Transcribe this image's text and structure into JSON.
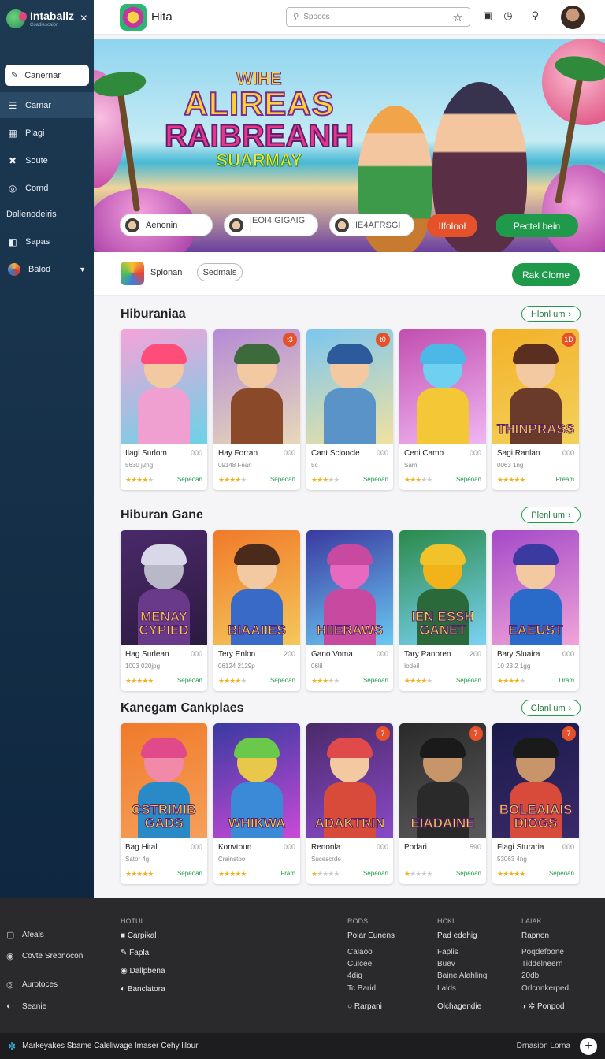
{
  "sidebar": {
    "logo_title": "Intaballz",
    "logo_subtitle": "Coadiescaion",
    "close_icon": "×",
    "primary_button": "Canernar",
    "items": [
      {
        "label": "Camar",
        "icon": "menu-icon",
        "active": true
      },
      {
        "label": "Plagi",
        "icon": "store-icon"
      },
      {
        "label": "Soute",
        "icon": "tools-icon"
      },
      {
        "label": "Comd",
        "icon": "chat-icon"
      }
    ],
    "group_label": "Dallenodeiris",
    "items2": [
      {
        "label": "Sapas",
        "icon": "bag-icon"
      },
      {
        "label": "Balod",
        "icon": "avatar-icon"
      }
    ]
  },
  "header": {
    "brand_name": "Hita",
    "search_placeholder": "Spoocs",
    "icons": [
      "bookmark-icon",
      "history-icon",
      "search-icon"
    ]
  },
  "hero": {
    "title_line1": "WIHE",
    "title_line2": "ALIREAS",
    "title_line3": "RAIBREANH",
    "title_line4": "SUARMAY",
    "pills": [
      "Aenonin",
      "IEOI4 GIGAIG I",
      "IE4AFRSGI"
    ],
    "button_orange": "Ilfolool",
    "button_green": "Pectel bein"
  },
  "filter": {
    "label": "Splonan",
    "chip": "Sedmals",
    "button": "Rak Clorne"
  },
  "sections": [
    {
      "title": "Hiburaniaa",
      "more": "Hlonl um",
      "cards": [
        {
          "name": "Ilagi Surlom",
          "num": "000",
          "sub": "5630 j2ng",
          "stars": 4,
          "stat": "Sepeoan",
          "badge": "",
          "thumb": "",
          "theme": [
            "#f6a3d8",
            "#6bd2e8",
            "#ff4d7a",
            "#f3c9a2",
            "#f0a0d0"
          ]
        },
        {
          "name": "Hay  Forran",
          "num": "000",
          "sub": "09148 Fean",
          "stars": 4,
          "stat": "Sepeoan",
          "badge": "t3",
          "thumb": "",
          "theme": [
            "#b58ad6",
            "#e7d8b9",
            "#3d6a3a",
            "#f3c9a2",
            "#8a4a2a"
          ]
        },
        {
          "name": "Cant Scloocle",
          "num": "000",
          "sub": "5c",
          "stars": 3,
          "stat": "Sepeoan",
          "badge": "t0",
          "thumb": "",
          "theme": [
            "#7cc6ef",
            "#f0e1a0",
            "#2d5a9a",
            "#f3c9a2",
            "#5a93c8"
          ]
        },
        {
          "name": "Ceni Camb",
          "num": "000",
          "sub": "Sam",
          "stars": 3,
          "stat": "Sepeoan",
          "badge": "",
          "thumb": "",
          "theme": [
            "#c14fb0",
            "#f0b6f2",
            "#4bb8e6",
            "#6fd0f2",
            "#f3c736"
          ]
        },
        {
          "name": "Sagi Ranlan",
          "num": "000",
          "sub": "0063 1ng",
          "stars": 5,
          "stat": "Pream",
          "badge": "1D",
          "thumb": "THINPRASS",
          "theme": [
            "#f3b12a",
            "#f3d15a",
            "#5a2f20",
            "#f3c9a2",
            "#6a3a2a"
          ]
        }
      ]
    },
    {
      "title": "Hiburan Gane",
      "more": "Plenl um",
      "cards": [
        {
          "name": "Hag Surlean",
          "num": "000",
          "sub": "1003 020jpg",
          "stars": 5,
          "stat": "Sepeoan",
          "badge": "",
          "thumb": "MENAY CYPIED",
          "theme": [
            "#4a2a6a",
            "#2c1a40",
            "#d8d8e8",
            "#b8b8c8",
            "#6a3a8a"
          ]
        },
        {
          "name": "Tery Enlon",
          "num": "200",
          "sub": "06124 2129p",
          "stars": 4,
          "stat": "Sepeoan",
          "badge": "",
          "thumb": "BIAAIIES",
          "theme": [
            "#f07a2a",
            "#f5c75a",
            "#4a2a1a",
            "#f3c9a2",
            "#3a6ac8"
          ]
        },
        {
          "name": "Gano Voma",
          "num": "000",
          "sub": "06lil",
          "stars": 3,
          "stat": "Sepeoan",
          "badge": "",
          "thumb": "HIIERAWS",
          "theme": [
            "#3a3aa0",
            "#6ac8f2",
            "#c84aa0",
            "#e86ac0",
            "#c84aa0"
          ]
        },
        {
          "name": "Tary Panoren",
          "num": "200",
          "sub": "Iodeil",
          "stars": 4,
          "stat": "Sepeoan",
          "badge": "",
          "thumb": "IEN ESSH GANET",
          "theme": [
            "#2a8a4a",
            "#7ad2f2",
            "#f2c22a",
            "#f2b21a",
            "#2a6a3a"
          ]
        },
        {
          "name": "Bary Sluaira",
          "num": "000",
          "sub": "10 23 2 1gg",
          "stars": 4,
          "stat": "Dram",
          "badge": "",
          "thumb": "EAEUST",
          "theme": [
            "#a44ac8",
            "#f0a4d8",
            "#3a3aa0",
            "#f3c9a2",
            "#2a6ac8"
          ]
        }
      ]
    },
    {
      "title": "Kanegam Cankplaes",
      "more": "Glanl um",
      "cards": [
        {
          "name": "Bag Hital",
          "num": "000",
          "sub": "Sator 4g",
          "stars": 5,
          "stat": "Sepeoan",
          "badge": "",
          "thumb": "CSTRIMIB GADS",
          "theme": [
            "#f07a2a",
            "#f5a05a",
            "#e04a8a",
            "#f08aa8",
            "#2a8ac8"
          ]
        },
        {
          "name": "Konvtoun",
          "num": "000",
          "sub": "Crainstoo",
          "stars": 5,
          "stat": "Fram",
          "badge": "",
          "thumb": "WHIKWA",
          "theme": [
            "#3a3aa0",
            "#c84ad8",
            "#6ac84a",
            "#e8c84a",
            "#3a8ad8"
          ]
        },
        {
          "name": "Renonla",
          "num": "000",
          "sub": "Sucescrde",
          "stars": 1,
          "stat": "Sepeoan",
          "badge": "7",
          "thumb": "ADAKTRIN",
          "theme": [
            "#4a2a6a",
            "#8a4ac8",
            "#e04a4a",
            "#f3c9a2",
            "#d84a3a"
          ]
        },
        {
          "name": "Podari",
          "num": "590",
          "sub": "",
          "stars": 1,
          "stat": "Sepeoan",
          "badge": "7",
          "thumb": "EIADAINE",
          "theme": [
            "#2a2a2a",
            "#5a5a5a",
            "#1a1a1a",
            "#c8946a",
            "#2a2a2a"
          ]
        },
        {
          "name": "Fiagi Sturaria",
          "num": "000",
          "sub": "53063 4ng",
          "stars": 5,
          "stat": "Sepeoan",
          "badge": "7",
          "thumb": "BOLEAIAIS DIOGS",
          "theme": [
            "#1a1a4a",
            "#3a2a6a",
            "#1a1a1a",
            "#c8946a",
            "#d84a3a"
          ]
        }
      ]
    }
  ],
  "footer": {
    "left_items": [
      {
        "label": "Afeals",
        "icon": "edit-icon"
      },
      {
        "label": "Covte Sreonocon",
        "icon": "settings-icon"
      },
      {
        "label": "Aurotoces",
        "icon": "refresh-icon"
      },
      {
        "label": "Seanie",
        "icon": "moon-icon"
      }
    ],
    "col1": {
      "heading": "HOTUI",
      "links": [
        {
          "label": "Carpikal",
          "icon": "■"
        },
        {
          "label": "Fapla",
          "icon": "✎"
        },
        {
          "label": "Dallpbena",
          "icon": "◉"
        },
        {
          "label": "Banclatora",
          "icon": "◐"
        }
      ]
    },
    "col2": {
      "heading": "RODS",
      "links": [
        "Polar Eunens",
        "Calaoo",
        "Culcee",
        "4dig",
        "Tc Barid",
        "Rarpani"
      ],
      "bullet": "○"
    },
    "col3": {
      "heading": "HCKI",
      "links": [
        "Pad edehig",
        "Faplis",
        "Buev",
        "Baine Alahling",
        "Lalds",
        "Olchagendie"
      ]
    },
    "col4": {
      "heading": "LAIAK",
      "links": [
        "Rapnon",
        "Poqdefbone",
        "Tiddelneern",
        "20db",
        "Orlcnnkerped",
        "Ponpod"
      ]
    }
  },
  "bottom_bar": {
    "text": "Markeyakes Sbame Caleliwage Imaser Cehy lilour",
    "right": "Drnasion Lorna"
  }
}
